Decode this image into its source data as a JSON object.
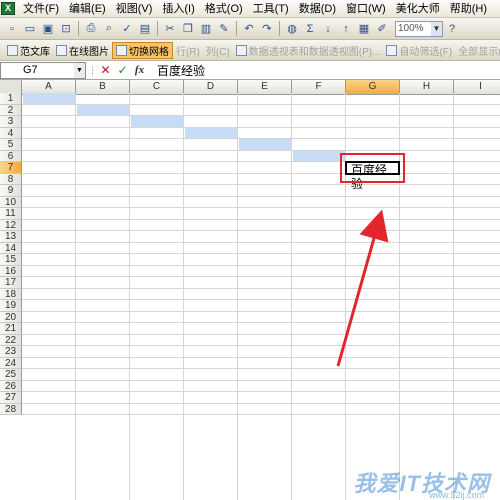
{
  "menu": {
    "app_icon": "excel-app-icon",
    "items": [
      "文件(F)",
      "编辑(E)",
      "视图(V)",
      "插入(I)",
      "格式(O)",
      "工具(T)",
      "数据(D)",
      "窗口(W)",
      "美化大师",
      "帮助(H)"
    ]
  },
  "toolbar1": {
    "zoom": "100%",
    "icons": [
      "new-icon",
      "open-icon",
      "save-icon",
      "permission-icon",
      "print-icon",
      "print-preview-icon",
      "spelling-icon",
      "research-icon",
      "cut-icon",
      "copy-icon",
      "paste-icon",
      "format-painter-icon",
      "undo-icon",
      "redo-icon",
      "hyperlink-icon",
      "autosum-icon",
      "sort-asc-icon",
      "sort-desc-icon",
      "chart-icon",
      "drawing-icon"
    ]
  },
  "toolbar2": {
    "items": [
      {
        "label": "范文库",
        "state": "normal"
      },
      {
        "label": "在线图片",
        "state": "normal"
      },
      {
        "label": "切换网格",
        "state": "active"
      },
      {
        "label": "行(R)",
        "state": "disabled"
      },
      {
        "label": "列(C)",
        "state": "disabled"
      },
      {
        "label": "数据透视表和数据透视图(P)...",
        "state": "disabled"
      },
      {
        "label": "自动筛选(F)",
        "state": "disabled"
      },
      {
        "label": "全部显示(S)",
        "state": "disabled"
      }
    ]
  },
  "formula_bar": {
    "name_box": "G7",
    "cancel": "✕",
    "enter": "✓",
    "fx": "fx",
    "value": "百度经验"
  },
  "grid": {
    "columns": [
      "A",
      "B",
      "C",
      "D",
      "E",
      "F",
      "G",
      "H",
      "I"
    ],
    "rows": [
      "1",
      "2",
      "3",
      "4",
      "5",
      "6",
      "7",
      "8",
      "9",
      "10",
      "11",
      "12",
      "13",
      "14",
      "15",
      "16",
      "17",
      "18",
      "19",
      "20",
      "21",
      "22",
      "23",
      "24",
      "25",
      "26",
      "27",
      "28"
    ],
    "selected_column": "G",
    "selected_row": "7",
    "highlighted_cells": [
      [
        "A",
        "1"
      ],
      [
        "B",
        "2"
      ],
      [
        "C",
        "3"
      ],
      [
        "D",
        "4"
      ],
      [
        "E",
        "5"
      ],
      [
        "F",
        "6"
      ]
    ],
    "active_cell": {
      "ref": "G7",
      "value": "百度经验"
    },
    "highlight_color": "#c6dcf7",
    "callout_color": "#e2262b"
  },
  "watermark": {
    "text": "我爱IT技术网",
    "url": "www.52ij.com"
  }
}
